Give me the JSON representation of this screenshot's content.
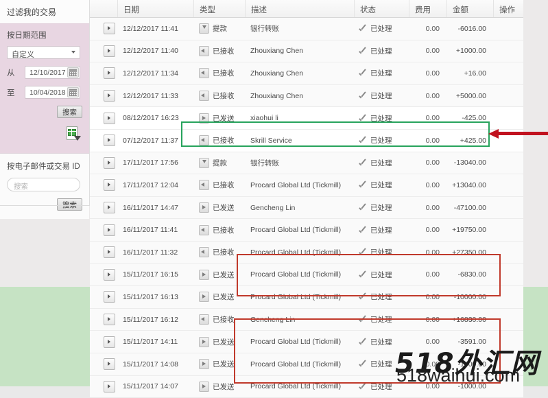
{
  "sidebar": {
    "title": "过滤我的交易",
    "date_panel": {
      "heading": "按日期范围",
      "range_select_value": "自定义",
      "from_label": "从",
      "from_value": "12/10/2017",
      "to_label": "至",
      "to_value": "10/04/2018",
      "search_button": "搜索",
      "export_icon": "csv-download-icon"
    },
    "id_panel": {
      "heading": "按电子邮件或交易 ID",
      "search_placeholder": "搜索",
      "search_button": "搜索"
    }
  },
  "table": {
    "columns": [
      "",
      "日期",
      "类型",
      "描述",
      "状态",
      "费用",
      "金额",
      "操作"
    ],
    "rows": [
      {
        "date": "12/12/2017 11:41",
        "icon": "down",
        "type": "提款",
        "desc": "银行转账",
        "status": "已处理",
        "fee": "0.00",
        "amount": "-6016.00",
        "sign": "neg"
      },
      {
        "date": "12/12/2017 11:40",
        "icon": "left",
        "type": "已接收",
        "desc": "Zhouxiang Chen",
        "status": "已处理",
        "fee": "0.00",
        "amount": "+1000.00",
        "sign": "pos"
      },
      {
        "date": "12/12/2017 11:34",
        "icon": "left",
        "type": "已接收",
        "desc": "Zhouxiang Chen",
        "status": "已处理",
        "fee": "0.00",
        "amount": "+16.00",
        "sign": "pos"
      },
      {
        "date": "12/12/2017 11:33",
        "icon": "left",
        "type": "已接收",
        "desc": "Zhouxiang Chen",
        "status": "已处理",
        "fee": "0.00",
        "amount": "+5000.00",
        "sign": "pos"
      },
      {
        "date": "08/12/2017 16:23",
        "icon": "right",
        "type": "已发送",
        "desc": "xiaohui li",
        "status": "已处理",
        "fee": "0.00",
        "amount": "-425.00",
        "sign": "neg"
      },
      {
        "date": "07/12/2017 11:37",
        "icon": "left",
        "type": "已接收",
        "desc": "Skrill Service",
        "status": "已处理",
        "fee": "0.00",
        "amount": "+425.00",
        "sign": "pos"
      },
      {
        "date": "17/11/2017 17:56",
        "icon": "down",
        "type": "提款",
        "desc": "银行转账",
        "status": "已处理",
        "fee": "0.00",
        "amount": "-13040.00",
        "sign": "neg"
      },
      {
        "date": "17/11/2017 12:04",
        "icon": "left",
        "type": "已接收",
        "desc": "Procard Global Ltd (Tickmill)",
        "status": "已处理",
        "fee": "0.00",
        "amount": "+13040.00",
        "sign": "pos"
      },
      {
        "date": "16/11/2017 14:47",
        "icon": "right",
        "type": "已发送",
        "desc": "Gencheng Lin",
        "status": "已处理",
        "fee": "0.00",
        "amount": "-47100.00",
        "sign": "neg"
      },
      {
        "date": "16/11/2017 11:41",
        "icon": "left",
        "type": "已接收",
        "desc": "Procard Global Ltd (Tickmill)",
        "status": "已处理",
        "fee": "0.00",
        "amount": "+19750.00",
        "sign": "pos"
      },
      {
        "date": "16/11/2017 11:32",
        "icon": "left",
        "type": "已接收",
        "desc": "Procard Global Ltd (Tickmill)",
        "status": "已处理",
        "fee": "0.00",
        "amount": "+27350.00",
        "sign": "pos"
      },
      {
        "date": "15/11/2017 16:15",
        "icon": "right",
        "type": "已发送",
        "desc": "Procard Global Ltd (Tickmill)",
        "status": "已处理",
        "fee": "0.00",
        "amount": "-6830.00",
        "sign": "neg"
      },
      {
        "date": "15/11/2017 16:13",
        "icon": "right",
        "type": "已发送",
        "desc": "Procard Global Ltd (Tickmill)",
        "status": "已处理",
        "fee": "0.00",
        "amount": "-10000.00",
        "sign": "neg"
      },
      {
        "date": "15/11/2017 16:12",
        "icon": "left",
        "type": "已接收",
        "desc": "Gencheng Lin",
        "status": "已处理",
        "fee": "0.00",
        "amount": "+16830.00",
        "sign": "pos"
      },
      {
        "date": "15/11/2017 14:11",
        "icon": "right",
        "type": "已发送",
        "desc": "Procard Global Ltd (Tickmill)",
        "status": "已处理",
        "fee": "0.00",
        "amount": "-3591.00",
        "sign": "neg"
      },
      {
        "date": "15/11/2017 14:08",
        "icon": "right",
        "type": "已发送",
        "desc": "Procard Global Ltd (Tickmill)",
        "status": "已处理",
        "fee": "0.00",
        "amount": "-1000.00",
        "sign": "neg"
      },
      {
        "date": "15/11/2017 14:07",
        "icon": "right",
        "type": "已发送",
        "desc": "Procard Global Ltd (Tickmill)",
        "status": "已处理",
        "fee": "0.00",
        "amount": "-1000.00",
        "sign": "neg"
      }
    ]
  },
  "annotations": {
    "highlight_green_row_index": 5,
    "arrow_color": "#c1121f",
    "green_box_color": "#27a35c",
    "red_box_color": "#c0392b"
  },
  "watermark": {
    "line1": "518外汇网",
    "line2": "518waihui.com"
  }
}
